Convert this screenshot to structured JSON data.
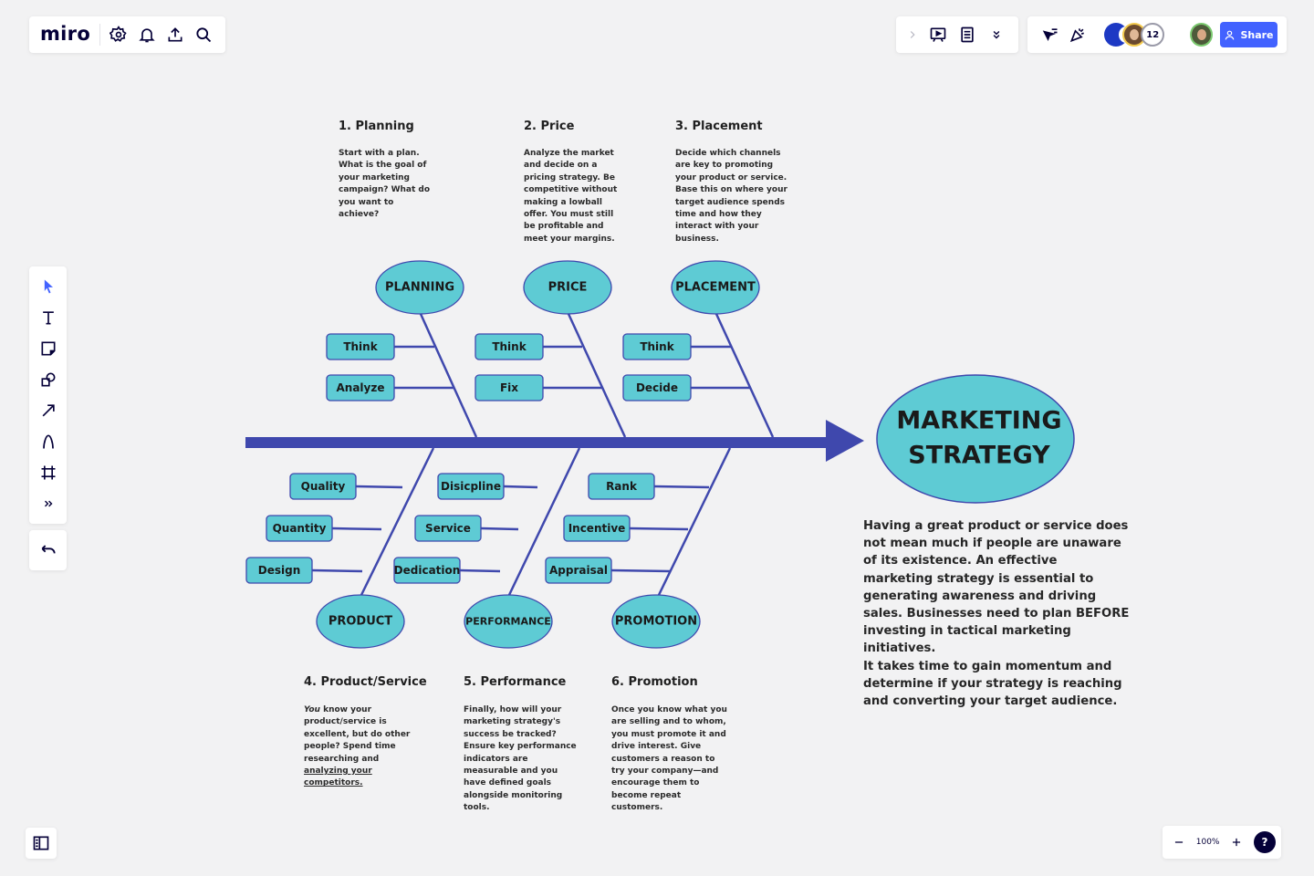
{
  "app": {
    "logo": "miro",
    "toolbar_top_left": [
      "settings-icon",
      "bell-icon",
      "upload-icon",
      "search-icon"
    ],
    "toolbar_top_right": [
      "chevron-right-icon",
      "presentation-icon",
      "notes-icon",
      "chevrons-down-icon"
    ],
    "collab": {
      "icons": [
        "cursor-follow-icon",
        "celebrate-icon"
      ],
      "avatar_count": "12",
      "share_label": "Share"
    },
    "left_tools": [
      "select-icon",
      "text-icon",
      "sticky-note-icon",
      "shapes-icon",
      "arrow-icon",
      "pen-icon",
      "frame-icon",
      "more-icon"
    ],
    "undo": "undo-icon",
    "zoom_level": "100%",
    "help": "?",
    "colors": {
      "accent": "#4262ff",
      "bone": "#3f48ad",
      "node_fill": "#5ecbd4",
      "node_stroke": "#3f48ad",
      "canvas": "#f2f2f3"
    }
  },
  "sections_top": [
    {
      "heading": "1. Planning",
      "lines": [
        "Start with a plan.",
        "What is the goal of",
        "your marketing",
        "campaign? What do",
        "you want to",
        "achieve?"
      ]
    },
    {
      "heading": "2. Price",
      "lines": [
        "Analyze the market",
        "and decide on a",
        "pricing strategy. Be",
        "competitive without",
        "making a lowball",
        "offer. You must still",
        "be profitable and",
        "meet your margins."
      ]
    },
    {
      "heading": "3. Placement",
      "lines": [
        "Decide which channels",
        "are key to promoting",
        "your product or service.",
        "Base this on where your",
        "target audience spends",
        "time and how they",
        "interact with your",
        "business."
      ]
    }
  ],
  "sections_bottom": [
    {
      "heading": "4. Product/Service",
      "lines": [
        "You know your",
        "product/service is",
        "excellent, but do other",
        "people? Spend time",
        "researching and",
        "analyzing your",
        "competitors."
      ]
    },
    {
      "heading": "5. Performance",
      "lines": [
        "Finally, how will your",
        "marketing strategy's",
        "success be tracked?",
        "Ensure key performance",
        "indicators are",
        "measurable and you",
        "have defined goals",
        "alongside monitoring",
        "tools."
      ]
    },
    {
      "heading": "6. Promotion",
      "lines": [
        "Once you know what you",
        "are selling and to whom,",
        "you must promote it and",
        "drive interest. Give",
        "customers a reason to",
        "try your company—and",
        "encourage them to",
        "become repeat",
        "customers."
      ]
    }
  ],
  "fishbone": {
    "head": [
      "MARKETING",
      "STRATEGY"
    ],
    "top_bones": [
      {
        "label": "PLANNING",
        "causes": [
          "Think",
          "Analyze"
        ]
      },
      {
        "label": "PRICE",
        "causes": [
          "Think",
          "Fix"
        ]
      },
      {
        "label": "PLACEMENT",
        "causes": [
          "Think",
          "Decide"
        ]
      }
    ],
    "bottom_bones": [
      {
        "label": "PRODUCT",
        "causes": [
          "Quality",
          "Quantity",
          "Design"
        ]
      },
      {
        "label": "PERFORMANCE",
        "causes": [
          "Disicpline",
          "Service",
          "Dedication"
        ]
      },
      {
        "label": "PROMOTION",
        "causes": [
          "Rank",
          "Incentive",
          "Appraisal"
        ]
      }
    ]
  },
  "summary": {
    "paragraph1": "Having a great product or service does not mean much if people are unaware of its existence. An effective marketing strategy is essential to generating awareness and driving sales. Businesses need to plan BEFORE investing in tactical marketing initiatives.",
    "paragraph2": "It takes time to gain momentum and determine if your strategy is reaching and converting your target audience."
  }
}
